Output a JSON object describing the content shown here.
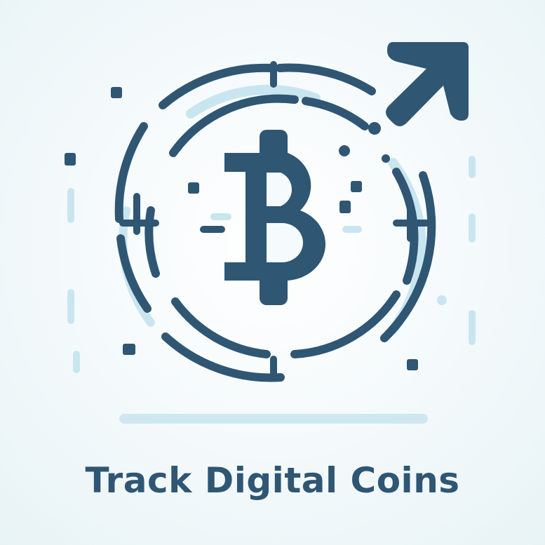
{
  "caption": {
    "text": "Track Digital Coins"
  },
  "colors": {
    "primary": "#2f5673",
    "accent_light": "#c9e6f0",
    "background": "#f3f9fb"
  },
  "icons": {
    "coin": "bitcoin-coin-icon",
    "arrow": "trend-up-arrow-icon"
  }
}
